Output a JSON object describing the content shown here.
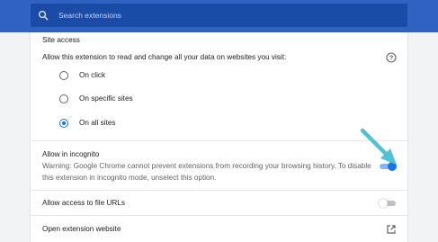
{
  "search": {
    "placeholder": "Search extensions"
  },
  "site_access": {
    "heading": "Site access",
    "description": "Allow this extension to read and change all your data on websites you visit:",
    "options": [
      {
        "label": "On click",
        "checked": false
      },
      {
        "label": "On specific sites",
        "checked": false
      },
      {
        "label": "On all sites",
        "checked": true
      }
    ]
  },
  "incognito": {
    "title": "Allow in incognito",
    "warning_line1": "Warning: Google Chrome cannot prevent extensions from recording your browsing history. To disable",
    "warning_line2": "this extension in incognito mode, unselect this option.",
    "enabled": true
  },
  "file_urls": {
    "label": "Allow access to file URLs",
    "enabled": false
  },
  "website": {
    "label": "Open extension website"
  },
  "colors": {
    "header_bg": "#2f62c2",
    "search_bg": "#1a4ba6",
    "accent": "#1a73e8",
    "arrow": "#4fc3d6"
  }
}
